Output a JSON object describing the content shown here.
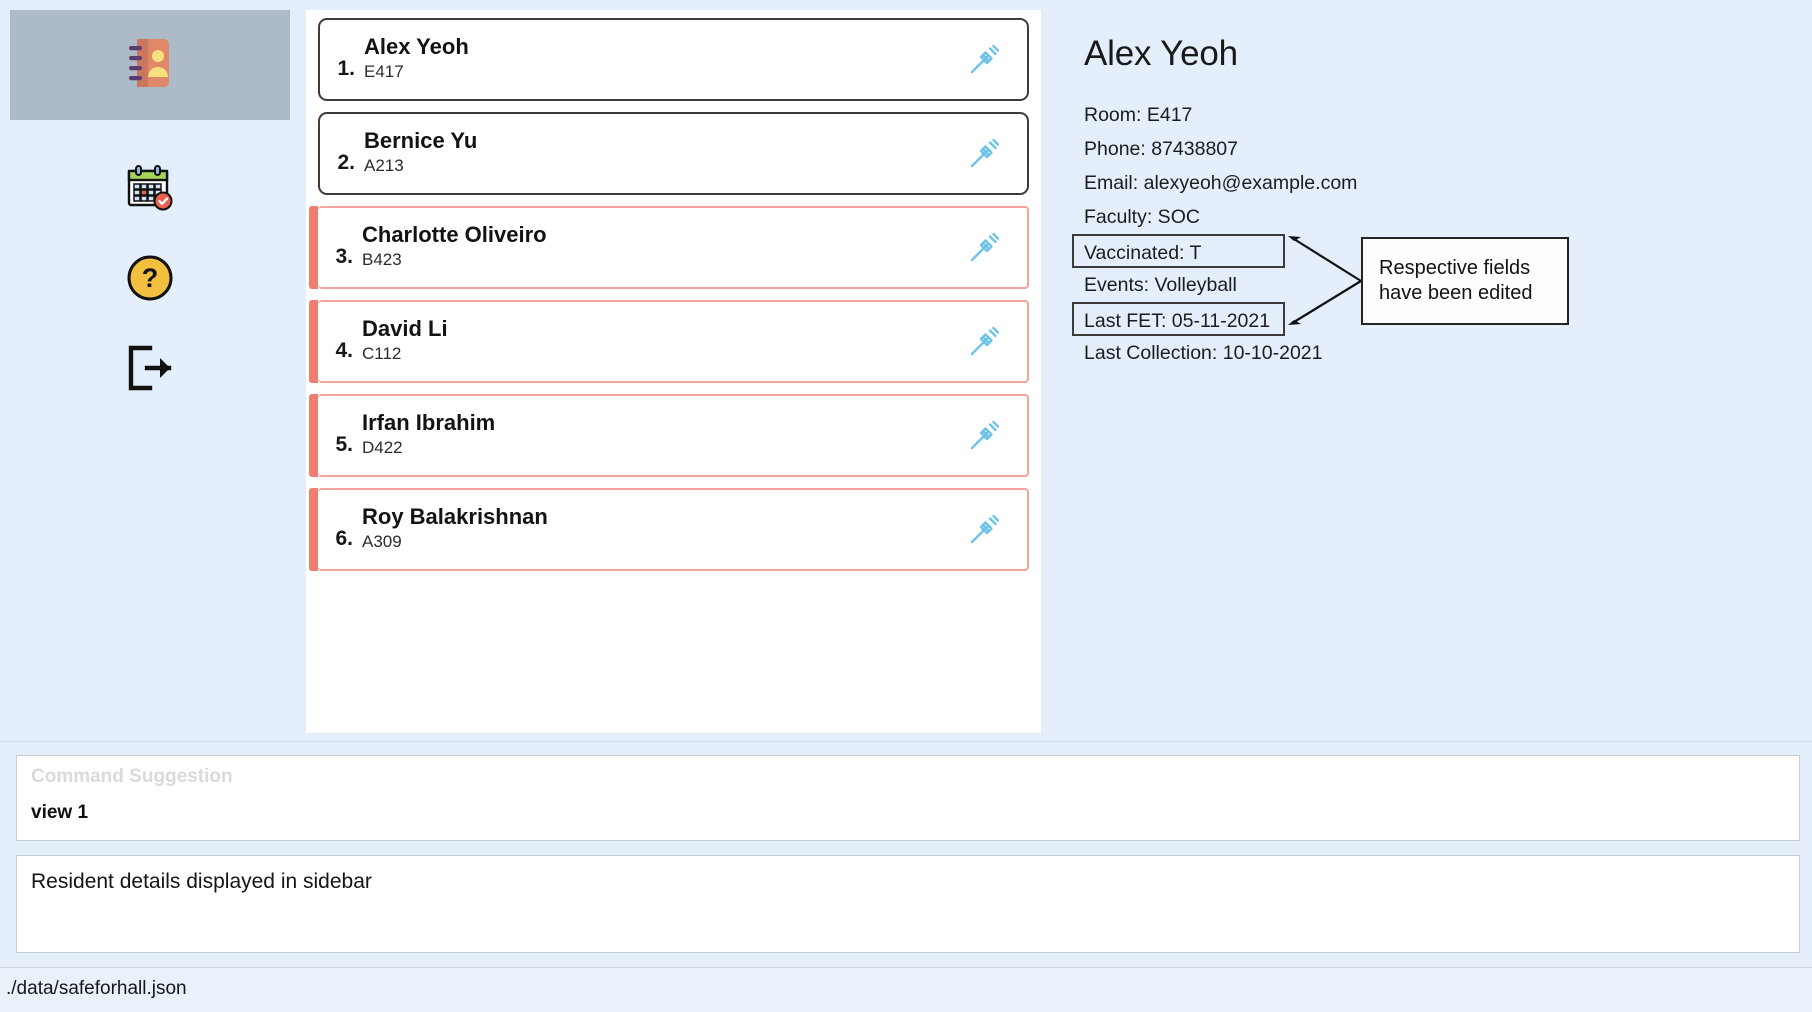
{
  "app": {
    "background_color": "#e4effb",
    "selected_tab_color": "#adbbc8",
    "flag_color": "#ee7f70",
    "syringe_color": "#6ec3e8"
  },
  "sidebar": {
    "items": [
      {
        "id": "residents",
        "icon": "address-book-icon",
        "selected": true
      },
      {
        "id": "events",
        "icon": "calendar-check-icon",
        "selected": false
      },
      {
        "id": "help",
        "icon": "question-circle-icon",
        "selected": false
      },
      {
        "id": "exit",
        "icon": "logout-icon",
        "selected": false
      }
    ]
  },
  "list": {
    "items": [
      {
        "index": "1.",
        "name": "Alex Yeoh",
        "room": "E417",
        "flagged": false,
        "icon": "syringe-icon"
      },
      {
        "index": "2.",
        "name": "Bernice Yu",
        "room": "A213",
        "flagged": false,
        "icon": "syringe-icon"
      },
      {
        "index": "3.",
        "name": "Charlotte Oliveiro",
        "room": "B423",
        "flagged": true,
        "icon": "syringe-icon"
      },
      {
        "index": "4.",
        "name": "David Li",
        "room": "C112",
        "flagged": true,
        "icon": "syringe-icon"
      },
      {
        "index": "5.",
        "name": "Irfan Ibrahim",
        "room": "D422",
        "flagged": true,
        "icon": "syringe-icon"
      },
      {
        "index": "6.",
        "name": "Roy Balakrishnan",
        "room": "A309",
        "flagged": true,
        "icon": "syringe-icon"
      }
    ]
  },
  "detail": {
    "title": "Alex Yeoh",
    "fields": [
      {
        "key": "room",
        "text": "Room: E417",
        "boxed": false
      },
      {
        "key": "phone",
        "text": "Phone: 87438807",
        "boxed": false
      },
      {
        "key": "email",
        "text": "Email: alexyeoh@example.com",
        "boxed": false
      },
      {
        "key": "faculty",
        "text": "Faculty: SOC",
        "boxed": false
      },
      {
        "key": "vaccinated",
        "text": "Vaccinated: T",
        "boxed": true
      },
      {
        "key": "events",
        "text": "Events: Volleyball",
        "boxed": false
      },
      {
        "key": "last_fet",
        "text": "Last FET: 05-11-2021",
        "boxed": true
      },
      {
        "key": "last_collection",
        "text": "Last Collection: 10-10-2021",
        "boxed": false
      }
    ]
  },
  "annotation": {
    "line1": "Respective fields",
    "line2": "have been edited"
  },
  "command": {
    "placeholder": "Command Suggestion",
    "value": "view 1"
  },
  "result": {
    "text": "Resident details displayed in sidebar"
  },
  "status": {
    "file_path": "./data/safeforhall.json"
  }
}
